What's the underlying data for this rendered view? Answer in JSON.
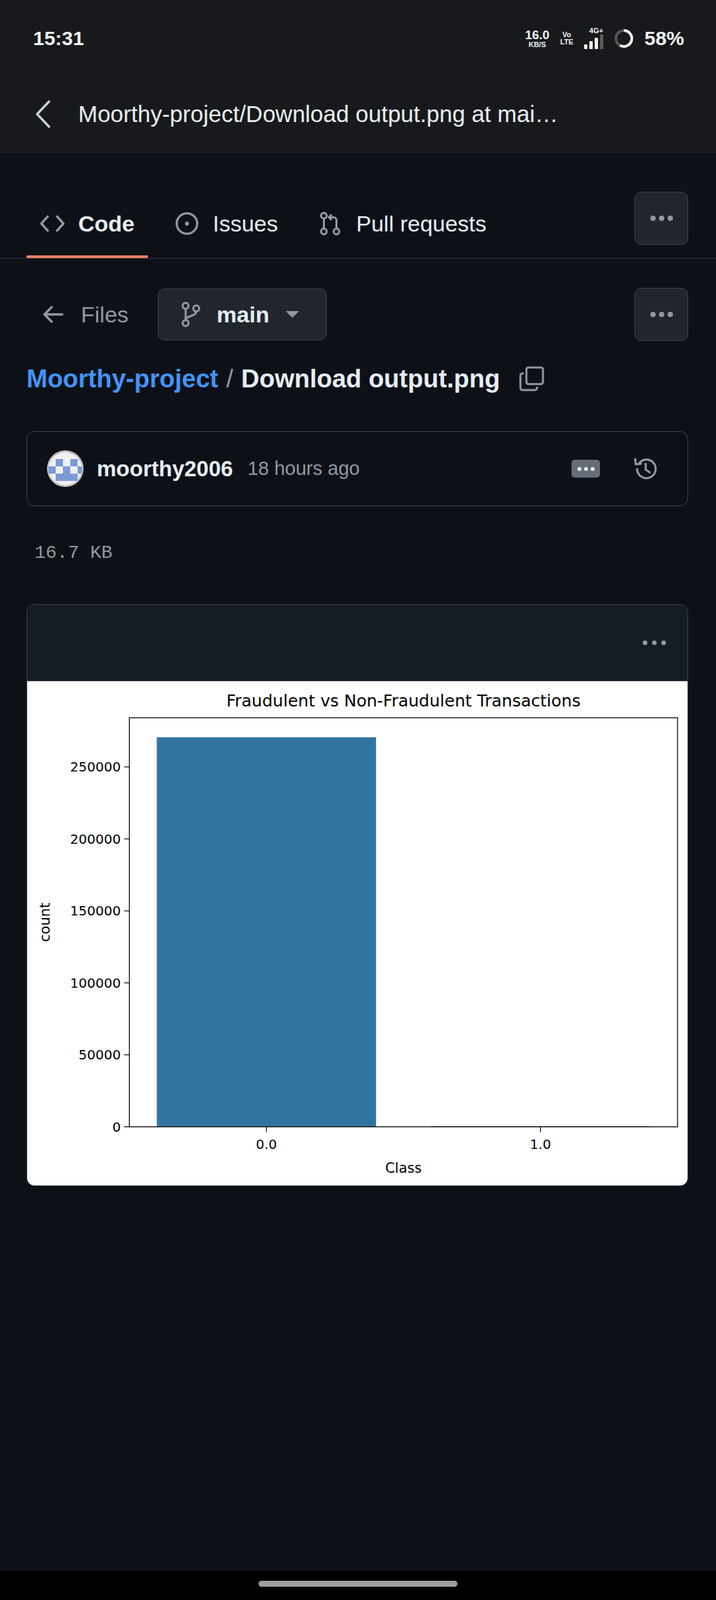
{
  "status_bar": {
    "time": "15:31",
    "net_speed": "16.0",
    "net_unit": "KB/S",
    "volte_top": "Vo",
    "volte_bottom": "LTE",
    "network": "4G+",
    "signal_level": 0.75,
    "battery": "58%",
    "battery_level": 0.58
  },
  "header": {
    "title": "Moorthy-project/Download output.png at mai…"
  },
  "tabs": [
    {
      "label": "Code",
      "selected": true
    },
    {
      "label": "Issues",
      "selected": false
    },
    {
      "label": "Pull requests",
      "selected": false
    }
  ],
  "files_link": "Files",
  "branch": "main",
  "breadcrumb": {
    "repo": "Moorthy-project",
    "separator": "/",
    "file": "Download output.png"
  },
  "commit": {
    "author": "moorthy2006",
    "time": "18 hours ago"
  },
  "file_size": "16.7 KB",
  "chart": {
    "title": "Fraudulent vs Non-Fraudulent Transactions",
    "y_label": "count",
    "x_label": "Class",
    "y_ticks": [
      "0",
      "50000",
      "100000",
      "150000",
      "200000",
      "250000"
    ],
    "categories": [
      "0.0",
      "1.0"
    ],
    "values": [
      270600,
      470
    ]
  }
}
